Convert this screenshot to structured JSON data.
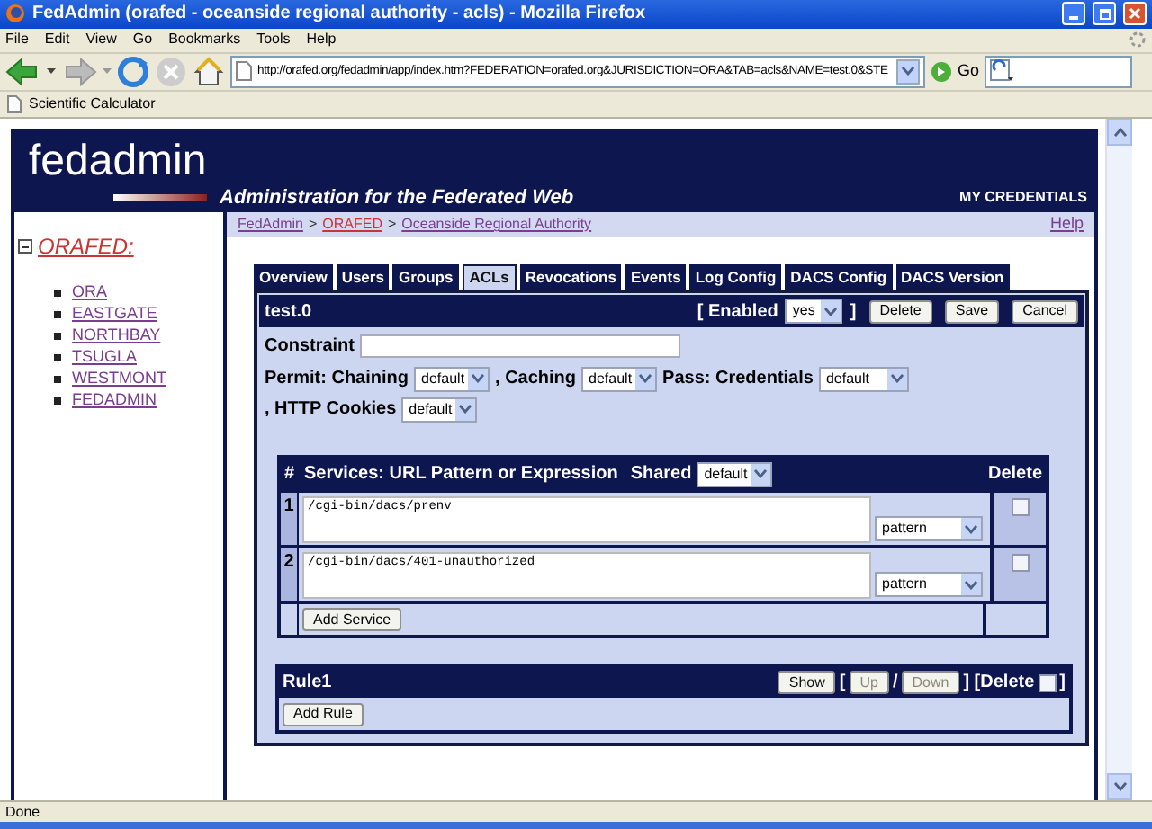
{
  "window": {
    "title": "FedAdmin (orafed - oceanside regional authority - acls) - Mozilla Firefox"
  },
  "menu_bar": [
    "File",
    "Edit",
    "View",
    "Go",
    "Bookmarks",
    "Tools",
    "Help"
  ],
  "toolbar": {
    "url": "http://orafed.org/fedadmin/app/index.htm?FEDERATION=orafed.org&JURISDICTION=ORA&TAB=acls&NAME=test.0&STE",
    "go_label": "Go"
  },
  "bookmarks": [
    "Scientific Calculator"
  ],
  "header": {
    "logo": "fedadmin",
    "tagline": "Administration for the Federated Web",
    "credentials": "MY CREDENTIALS"
  },
  "breadcrumb": [
    {
      "label": "FedAdmin",
      "color": "#7a3d8f"
    },
    {
      "label": ">",
      "kind": "separator"
    },
    {
      "label": "ORAFED",
      "color": "#cc3333"
    },
    {
      "label": ">",
      "kind": "separator"
    },
    {
      "label": "Oceanside Regional Authority",
      "color": "#7a3d8f"
    }
  ],
  "help_link": "Help",
  "tree": {
    "label": "ORAFED:",
    "expanded": true,
    "children": [
      {
        "label": "ORA"
      },
      {
        "label": "EASTGATE"
      },
      {
        "label": "NORTHBAY"
      },
      {
        "label": "TSUGLA"
      },
      {
        "label": "WESTMONT"
      },
      {
        "label": "FEDADMIN"
      }
    ]
  },
  "tabs": [
    {
      "label": "Overview",
      "selected": false
    },
    {
      "label": "Users",
      "selected": false
    },
    {
      "label": "Groups",
      "selected": false
    },
    {
      "label": "ACLs",
      "selected": true
    },
    {
      "label": "Revocations",
      "selected": false
    },
    {
      "label": "Events",
      "selected": false
    },
    {
      "label": "Log Config",
      "selected": false
    },
    {
      "label": "DACS Config",
      "selected": false
    },
    {
      "label": "DACS Version",
      "selected": false
    }
  ],
  "acl": {
    "name": "test.0",
    "enabled_prefix": "[ Enabled",
    "enabled_value": "yes",
    "enabled_suffix": "]",
    "buttons": [
      "Delete",
      "Save",
      "Cancel"
    ],
    "constraint_label": "Constraint",
    "permit_fields": [
      {
        "label": "Permit: Chaining",
        "value": "default"
      },
      {
        "label": ", Caching",
        "value": "default"
      },
      {
        "label": "Pass: Credentials",
        "value": "default"
      },
      {
        "label": ", HTTP Cookies",
        "value": "default"
      }
    ]
  },
  "services": {
    "number_heading": "#",
    "heading": "Services: URL Pattern or Expression",
    "shared_label": "Shared",
    "shared_value": "default",
    "delete_heading": "Delete",
    "rows": [
      {
        "number": "1",
        "url": "/cgi-bin/dacs/prenv",
        "match": "pattern",
        "checked": false
      },
      {
        "number": "2",
        "url": "/cgi-bin/dacs/401-unauthorized",
        "match": "pattern",
        "checked": false
      }
    ],
    "add_button": "Add Service"
  },
  "rule": {
    "title": "Rule1",
    "controls": [
      {
        "kind": "button",
        "label": "Show",
        "disabled": false
      },
      {
        "kind": "text",
        "label": "["
      },
      {
        "kind": "button",
        "label": "Up",
        "disabled": true
      },
      {
        "kind": "text",
        "label": "/"
      },
      {
        "kind": "button",
        "label": "Down",
        "disabled": true
      },
      {
        "kind": "text",
        "label": "] [Delete"
      },
      {
        "kind": "checkbox",
        "checked": false
      },
      {
        "kind": "text",
        "label": "]"
      }
    ],
    "add_button": "Add Rule"
  },
  "status_bar": "Done"
}
